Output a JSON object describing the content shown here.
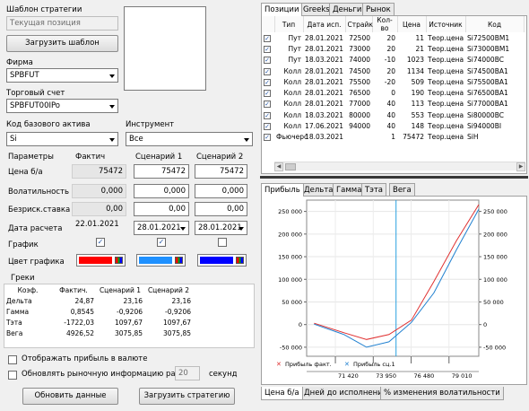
{
  "strategy_template": {
    "label": "Шаблон стратегии",
    "value": "Текущая позиция",
    "load_button": "Загрузить шаблон"
  },
  "firm": {
    "label": "Фирма",
    "value": "SPBFUT"
  },
  "account": {
    "label": "Торговый счет",
    "value": "SPBFUT00IPo"
  },
  "base_asset": {
    "label": "Код базового актива",
    "value": "Si"
  },
  "instrument": {
    "label": "Инструмент",
    "value": "Все"
  },
  "params": {
    "header": [
      "Параметры",
      "Фактич",
      "Сценарий 1",
      "Сценарий 2"
    ],
    "rows": [
      {
        "label": "Цена б/а",
        "fact": "75472",
        "s1": "75472",
        "s2": "75472"
      },
      {
        "label": "Волатильность",
        "fact": "0,000",
        "s1": "0,000",
        "s2": "0,000"
      },
      {
        "label": "Безриск.ставка",
        "fact": "0,00",
        "s1": "0,00",
        "s2": "0,00"
      },
      {
        "label": "Дата расчета",
        "fact": "22.01.2021",
        "s1": "28.01.2021",
        "s2": "28.01.2021"
      },
      {
        "label": "График"
      },
      {
        "label": "Цвет графика"
      }
    ],
    "chart_checks": [
      true,
      true,
      false
    ],
    "colors": [
      "#ff0000",
      "#1e90ff",
      "#0000ff"
    ]
  },
  "greeks": {
    "title": "Греки",
    "columns": [
      "Коэф.",
      "Фактич.",
      "Сценарий 1",
      "Сценарий 2"
    ],
    "rows": [
      [
        "Дельта",
        "24,87",
        "23,16",
        "23,16"
      ],
      [
        "Гамма",
        "0,8545",
        "-0,9206",
        "-0,9206"
      ],
      [
        "Тэта",
        "-1722,03",
        "1097,67",
        "1097,67"
      ],
      [
        "Вега",
        "4926,52",
        "3075,85",
        "3075,85"
      ]
    ]
  },
  "options": {
    "show_in_currency": "Отображать прибыль в валюте",
    "update_market": "Обновлять рыночную информацию раз в",
    "update_interval": "20",
    "seconds": "секунд"
  },
  "buttons": {
    "refresh": "Обновить данные",
    "load_strategy": "Загрузить стратегию"
  },
  "top_tabs": [
    "Позиции",
    "Greeks",
    "Деньги",
    "Рынок"
  ],
  "positions": {
    "columns": [
      "Тип",
      "Дата исп.",
      "Страйк",
      "Кол-во",
      "Цена",
      "Источник",
      "Код"
    ],
    "rows": [
      [
        "Пут",
        "28.01.2021",
        "72500",
        "20",
        "11",
        "Теор.цена",
        "Si72500BM1"
      ],
      [
        "Пут",
        "28.01.2021",
        "73000",
        "20",
        "21",
        "Теор.цена",
        "Si73000BM1"
      ],
      [
        "Пут",
        "18.03.2021",
        "74000",
        "-10",
        "1023",
        "Теор.цена",
        "Si74000BC"
      ],
      [
        "Колл",
        "28.01.2021",
        "74500",
        "20",
        "1134",
        "Теор.цена",
        "Si74500BA1"
      ],
      [
        "Колл",
        "28.01.2021",
        "75500",
        "-20",
        "509",
        "Теор.цена",
        "Si75500BA1"
      ],
      [
        "Колл",
        "28.01.2021",
        "76500",
        "0",
        "190",
        "Теор.цена",
        "Si76500BA1"
      ],
      [
        "Колл",
        "28.01.2021",
        "77000",
        "40",
        "113",
        "Теор.цена",
        "Si77000BA1"
      ],
      [
        "Колл",
        "18.03.2021",
        "80000",
        "40",
        "553",
        "Теор.цена",
        "Si80000BC"
      ],
      [
        "Колл",
        "17.06.2021",
        "94000",
        "40",
        "148",
        "Теор.цена",
        "Si94000BI"
      ],
      [
        "Фьючерс",
        "18.03.2021",
        "",
        "1",
        "75472",
        "Теор.цена",
        "SiH"
      ]
    ]
  },
  "chart_tabs": [
    "Прибыль",
    "Дельта",
    "Гамма",
    "Тэта",
    "Вега"
  ],
  "bottom_tabs": [
    "Цена б/а",
    "Дней до исполнения",
    "% изменения волатильности"
  ],
  "chart_data": {
    "type": "line",
    "x": [
      70000,
      72000,
      73500,
      75000,
      76500,
      78000,
      79500,
      81000
    ],
    "series": [
      {
        "name": "Прибыль факт.",
        "values": [
          3000,
          -18000,
          -33000,
          -22000,
          10000,
          95000,
          185000,
          265000
        ]
      },
      {
        "name": "Прибыль сц.1",
        "values": [
          1000,
          -22000,
          -50000,
          -38000,
          5000,
          70000,
          165000,
          255000
        ]
      }
    ],
    "y_ticks": [
      "250 000",
      "200 000",
      "150 000",
      "100 000",
      "50 000",
      "0",
      "-50 000"
    ],
    "x_ticks": [
      "71 420",
      "73 950",
      "76 480",
      "79 010"
    ],
    "ylim": [
      -70000,
      275000
    ],
    "xlim": [
      69500,
      81000
    ],
    "marker_x": 75472,
    "colors": [
      "#e03030",
      "#2080d0"
    ]
  }
}
